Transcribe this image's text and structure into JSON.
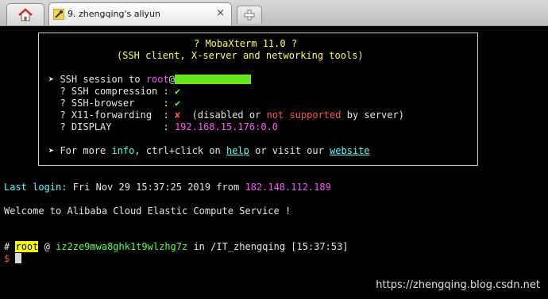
{
  "tabs": {
    "session_label": "9. zhengqing's aliyun",
    "close_glyph": "×",
    "home_icon": "home-icon",
    "new_tab_icon": "plus-icon"
  },
  "banner": {
    "title": "? MobaXterm 11.0 ?",
    "subtitle": "(SSH client, X-server and networking tools)",
    "ssh_prefix": "➤ SSH session to ",
    "ssh_user": "root",
    "ssh_at": "@",
    "compression_label": "  ? SSH compression : ",
    "compression_value": "✔",
    "browser_label": "  ? SSH-browser     : ",
    "browser_value": "✔",
    "x11_label": "  ? X11-forwarding  : ",
    "x11_value": "✘",
    "x11_note_1": "  (disabled or ",
    "x11_note_2": "not supported",
    "x11_note_3": " by server)",
    "display_label": "  ? DISPLAY         : ",
    "display_value": "192.168.15.176:0.0",
    "more_prefix": "➤ For more ",
    "more_info": "info",
    "more_mid": ", ctrl+click on ",
    "more_help": "help",
    "more_visit": " or visit our ",
    "more_website": "website"
  },
  "login": {
    "label": "Last login:",
    "datetime": " Fri Nov 29 15:37:25 2019 from ",
    "ip": "182.148.112.189"
  },
  "welcome": "Welcome to Alibaba Cloud Elastic Compute Service !",
  "prompt": {
    "hash": "#",
    "user": "root",
    "at": " @ ",
    "host": "iz2ze9mwa8ghk1t9wlzhg7z",
    "in": " in ",
    "path": "/IT_zhengqing",
    "time": " [15:37:53]",
    "dollar": "$"
  },
  "watermark": "https://zhengqing.blog.csdn.net"
}
